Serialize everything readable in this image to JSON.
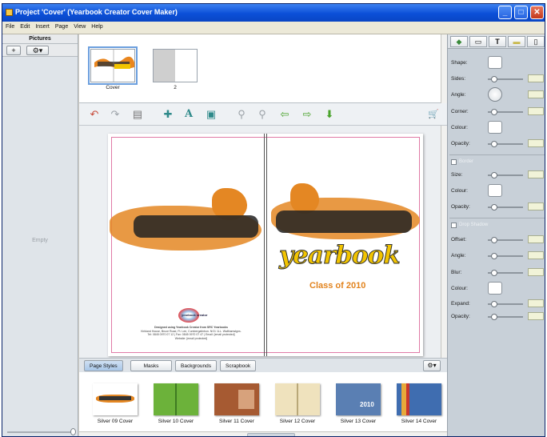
{
  "window": {
    "title": "Project 'Cover' (Yearbook Creator Cover Maker)",
    "controls": {
      "minimize": "_",
      "maximize": "□",
      "close": "✕"
    }
  },
  "menu": [
    "File",
    "Edit",
    "Insert",
    "Page",
    "View",
    "Help"
  ],
  "pictures_panel": {
    "header": "Pictures",
    "add_label": "+",
    "gear_label": "⚙▾",
    "empty_text": "Empty"
  },
  "pages": [
    {
      "label": "Cover",
      "selected": true
    },
    {
      "label": "2",
      "selected": false
    }
  ],
  "toolbar": [
    {
      "name": "undo-icon",
      "glyph": "↶"
    },
    {
      "name": "redo-icon",
      "glyph": "↷"
    },
    {
      "name": "delete-icon",
      "glyph": "▤"
    },
    {
      "name": "add-picture-icon",
      "glyph": "✚"
    },
    {
      "name": "add-text-icon",
      "glyph": "A"
    },
    {
      "name": "add-shape-icon",
      "glyph": "▣"
    },
    {
      "name": "zoom-out-icon",
      "glyph": "⚲"
    },
    {
      "name": "zoom-in-icon",
      "glyph": "⚲"
    },
    {
      "name": "back-arrow-icon",
      "glyph": "⇦"
    },
    {
      "name": "forward-arrow-icon",
      "glyph": "⇨"
    },
    {
      "name": "download-icon",
      "glyph": "⬇"
    },
    {
      "name": "cart-icon",
      "glyph": "🛒"
    }
  ],
  "cover": {
    "title_word": "yearbook",
    "subtitle": "Class of 2010",
    "logo_text": "yearbook creator",
    "publisher_lines": [
      "Designed using Yearbook Creator from SRC Yearbooks",
      "Kirkland House, Bruce Road, Ft. Lee, Cumbergalinbon. NG1 1LL. Walthamstgns.",
      "Tel: 0845 0970 07 12 | Fax: 0845 0970 07 47 | Email: [email protected]",
      "Website: [email protected]"
    ]
  },
  "tabs": [
    {
      "label": "Page Styles",
      "active": true
    },
    {
      "label": "Masks",
      "active": false
    },
    {
      "label": "Backgrounds",
      "active": false
    },
    {
      "label": "Scrapbook",
      "active": false
    }
  ],
  "styles": [
    {
      "label": "Silver 09 Cover",
      "color": "#ffffff"
    },
    {
      "label": "Silver 10 Cover",
      "color": "#6cb23a"
    },
    {
      "label": "Silver 11 Cover",
      "color": "#a65a32"
    },
    {
      "label": "Silver 12 Cover",
      "color": "#efe2bd"
    },
    {
      "label": "Silver 13 Cover",
      "color": "#5a7fb3"
    },
    {
      "label": "Silver 14 Cover",
      "color": "#3f6db0"
    }
  ],
  "style_13_text": "2010",
  "properties": {
    "shape_label": "Shape:",
    "sides_label": "Sides:",
    "angle_label": "Angle:",
    "corner_label": "Corner:",
    "colour_label": "Colour:",
    "opacity_label": "Opacity:",
    "border_check": "Border",
    "size_label": "Size:",
    "border_colour_label": "Colour:",
    "border_opacity_label": "Opacity:",
    "shadow_check": "Drop Shadow",
    "offset_label": "Offset:",
    "shadow_angle_label": "Angle:",
    "blur_label": "Blur:",
    "shadow_colour_label": "Colour:",
    "expand_label": "Expand:",
    "shadow_opacity_label": "Opacity:"
  },
  "right_tabs": [
    {
      "name": "shape-tab-icon",
      "glyph": "◆"
    },
    {
      "name": "frame-tab-icon",
      "glyph": "▭"
    },
    {
      "name": "text-tab-icon",
      "glyph": "T"
    },
    {
      "name": "ruler-tab-icon",
      "glyph": "▬"
    },
    {
      "name": "page-tab-icon",
      "glyph": "▯"
    }
  ]
}
